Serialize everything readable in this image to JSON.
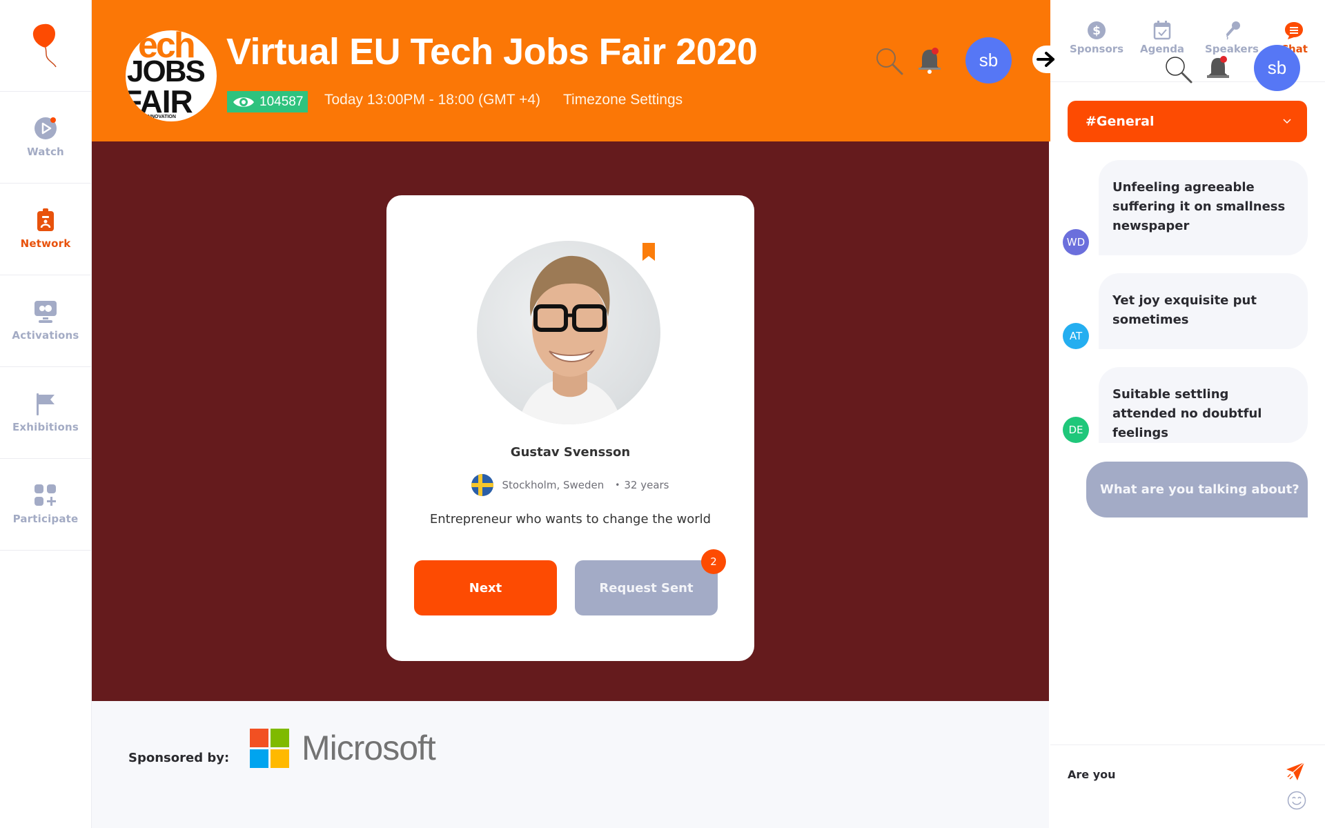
{
  "colors": {
    "header_orange": "#fb7706",
    "accent": "#fd4b02",
    "main_bg": "#651b1d",
    "muted": "#a3abc6",
    "avatar_blue": "#5677f5",
    "views_green": "#2ec27e"
  },
  "sidebar": {
    "logo": "balloon-logo",
    "items": [
      {
        "label": "Watch",
        "icon": "play-icon",
        "active": false,
        "has_dot": true
      },
      {
        "label": "Network",
        "icon": "id-badge-icon",
        "active": true
      },
      {
        "label": "Activations",
        "icon": "monitor-icon",
        "active": false
      },
      {
        "label": "Exhibitions",
        "icon": "flag-icon",
        "active": false
      },
      {
        "label": "Participate",
        "icon": "grid-plus-icon",
        "active": false
      }
    ]
  },
  "header": {
    "logo_text": {
      "top": "ech",
      "middle": "JOBS",
      "bottom": "FAIR",
      "tagline": "INNOVATION"
    },
    "title": "Virtual EU Tech Jobs Fair 2020",
    "views": "104587",
    "schedule": "Today 13:00PM - 18:00 (GMT +4)",
    "timezone_link": "Timezone Settings",
    "avatar_initials": "sb"
  },
  "profile": {
    "name": "Gustav Svensson",
    "location": "Stockholm, Sweden",
    "age": "32 years",
    "bio": "Entrepreneur who wants to change the world",
    "next_label": "Next",
    "request_label": "Request Sent",
    "request_count": "2"
  },
  "sponsor": {
    "label": "Sponsored by:",
    "name": "Microsoft"
  },
  "right_panel": {
    "tabs": [
      {
        "label": "Sponsors",
        "icon": "dollar-icon",
        "active": false
      },
      {
        "label": "Agenda",
        "icon": "calendar-icon",
        "active": false
      },
      {
        "label": "Speakers",
        "icon": "microphone-icon",
        "active": false
      },
      {
        "label": "Chat",
        "icon": "chat-icon",
        "active": true
      }
    ],
    "avatar_initials": "sb",
    "channel": "#General",
    "messages": [
      {
        "initials": "WD",
        "color": "#6b6fdc",
        "text": "Unfeeling agreeable suffering it on smallness newspaper"
      },
      {
        "initials": "AT",
        "color": "#24aef0",
        "text": "Yet joy exquisite put sometimes"
      },
      {
        "initials": "DE",
        "color": "#1fc77a",
        "text": "Suitable settling attended no doubtful feelings"
      }
    ],
    "own_message": "What are you talking about?",
    "composer_value": "Are you"
  }
}
